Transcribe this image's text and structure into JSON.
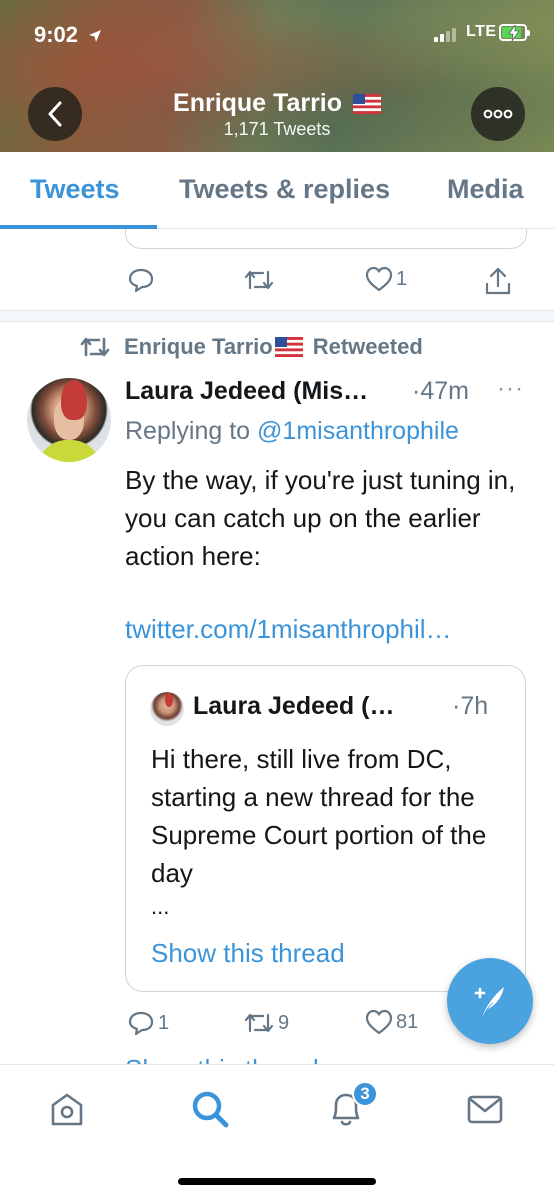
{
  "status_bar": {
    "time": "9:02",
    "network": "LTE",
    "battery_percent": 80,
    "signal_bars_filled": 2,
    "signal_bars_total": 4
  },
  "header": {
    "name": "Enrique Tarrio",
    "flag": "🇺🇸",
    "tweet_count": "1,171 Tweets",
    "back_icon": "chevron-left-icon",
    "more_icon": "more-horizontal-icon"
  },
  "tabs": [
    {
      "label": "Tweets",
      "active": true
    },
    {
      "label": "Tweets & replies",
      "active": false
    },
    {
      "label": "Media",
      "active": false
    }
  ],
  "prev_tweet": {
    "likes": "1"
  },
  "retweet": {
    "by": "Enrique Tarrio",
    "label": "Retweeted"
  },
  "tweet": {
    "author": "Laura Jedeed (Mis…",
    "time": "47m",
    "replying_prefix": "Replying to",
    "replying_to": "@1misanthrophile",
    "text": "By the way, if you're just tuning in, you can catch up on the earlier action here:",
    "link": "twitter.com/1misanthrophil…",
    "replies": "1",
    "retweets": "9",
    "likes": "81",
    "cutoff_text": "Show this thread"
  },
  "quote": {
    "author": "Laura Jedeed (…",
    "time": "7h",
    "text": "Hi there, still live from DC, starting a new thread for the Supreme Court portion of the day",
    "ellipsis": "...",
    "show_thread": "Show this thread"
  },
  "bottom_nav": {
    "items": [
      "home",
      "search",
      "notifications",
      "messages"
    ],
    "notification_count": "3"
  },
  "colors": {
    "accent": "#3b94d9",
    "muted": "#657786",
    "text": "#14171a",
    "border": "#e1e8ed"
  }
}
